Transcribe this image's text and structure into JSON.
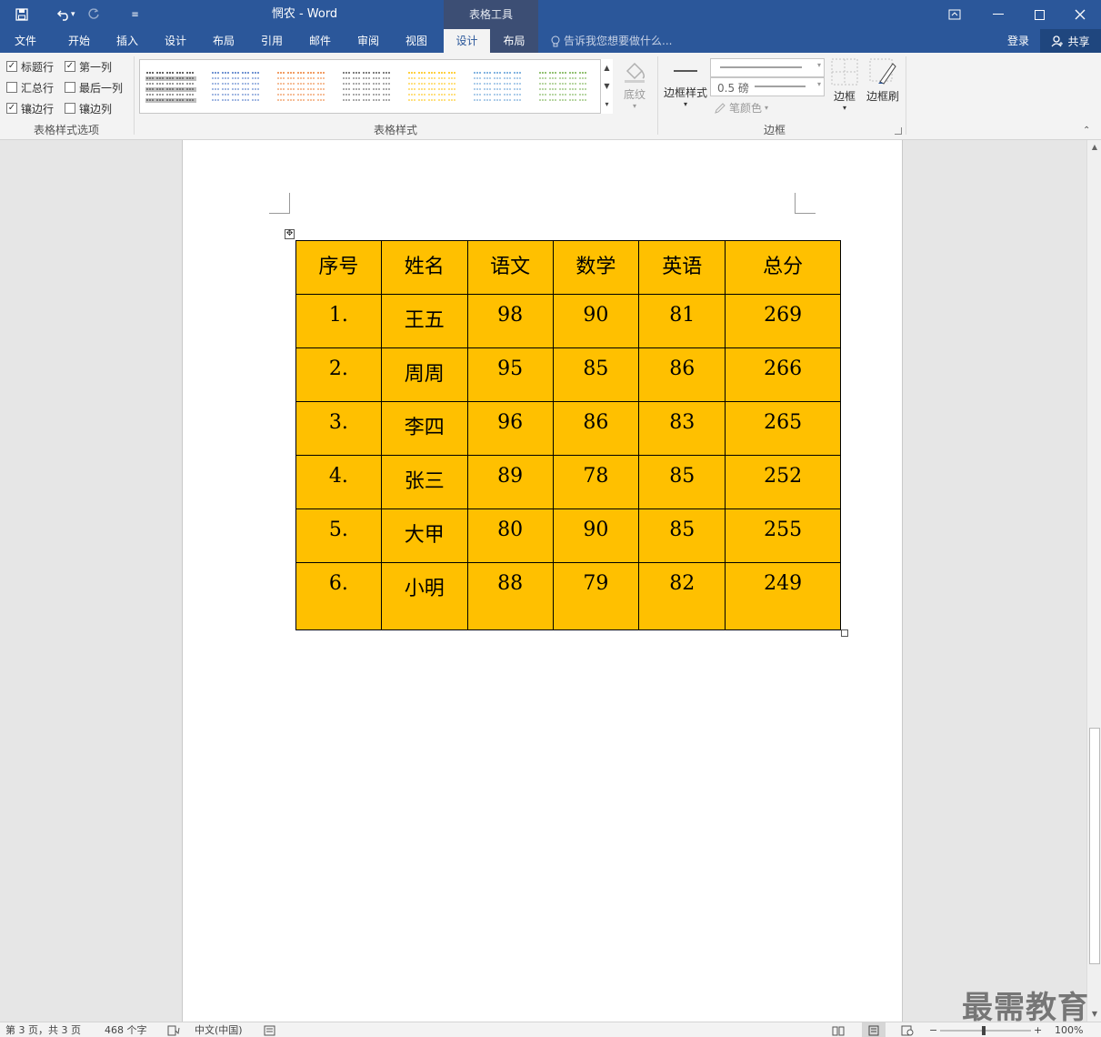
{
  "window": {
    "doc_title": "惘农 - Word",
    "context_header": "表格工具"
  },
  "tabs": [
    {
      "label": "文件"
    },
    {
      "label": "开始"
    },
    {
      "label": "插入"
    },
    {
      "label": "设计"
    },
    {
      "label": "布局"
    },
    {
      "label": "引用"
    },
    {
      "label": "邮件"
    },
    {
      "label": "审阅"
    },
    {
      "label": "视图"
    },
    {
      "label": "设计"
    },
    {
      "label": "布局"
    }
  ],
  "tell_me": "告诉我您想要做什么...",
  "account": {
    "login": "登录",
    "share": "共享"
  },
  "ribbon": {
    "style_options": {
      "label": "表格样式选项",
      "items": [
        {
          "label": "标题行",
          "checked": true
        },
        {
          "label": "第一列",
          "checked": true
        },
        {
          "label": "汇总行",
          "checked": false
        },
        {
          "label": "最后一列",
          "checked": false
        },
        {
          "label": "镶边行",
          "checked": true
        },
        {
          "label": "镶边列",
          "checked": false
        }
      ]
    },
    "table_styles": {
      "label": "表格样式",
      "thumb_colors": [
        "#333333",
        "#4472c4",
        "#ed7d31",
        "#555555",
        "#ffc000",
        "#5b9bd5",
        "#70ad47"
      ]
    },
    "shading": "底纹",
    "borders": {
      "label": "边框",
      "border_styles": "边框样式",
      "weight": "0.5 磅",
      "pen_color": "笔颜色",
      "borders_btn": "边框",
      "border_painter": "边框刷"
    }
  },
  "table": {
    "header": [
      "序号",
      "姓名",
      "语文",
      "数学",
      "英语",
      "总分"
    ],
    "rows": [
      [
        "1.",
        "王五",
        "98",
        "90",
        "81",
        "269"
      ],
      [
        "2.",
        "周周",
        "95",
        "85",
        "86",
        "266"
      ],
      [
        "3.",
        "李四",
        "96",
        "86",
        "83",
        "265"
      ],
      [
        "4.",
        "张三",
        "89",
        "78",
        "85",
        "252"
      ],
      [
        "5.",
        "大甲",
        "80",
        "90",
        "85",
        "255"
      ],
      [
        "6.",
        "小明",
        "88",
        "79",
        "82",
        "249"
      ]
    ],
    "fill_color": "#ffc000"
  },
  "status": {
    "page": "第 3 页，共 3 页",
    "words": "468 个字",
    "language": "中文(中国)",
    "zoom": "100%"
  },
  "watermark": "最需教育",
  "colors": {
    "title_bar": "#2b579a",
    "context_tab": "#3c4e74"
  }
}
